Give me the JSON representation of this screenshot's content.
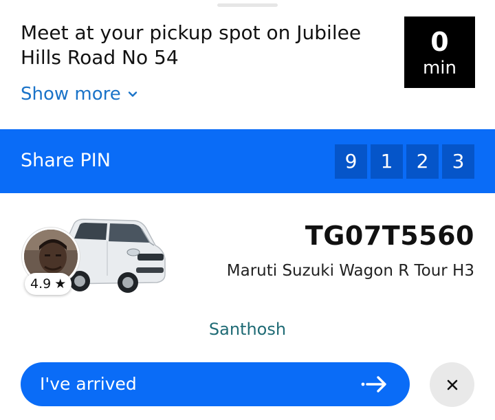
{
  "header": {
    "title": "Meet at your pickup spot on Jubilee Hills Road No 54",
    "show_more_label": "Show more",
    "eta": {
      "value": "0",
      "unit": "min"
    }
  },
  "pin": {
    "label": "Share PIN",
    "digits": [
      "9",
      "1",
      "2",
      "3"
    ]
  },
  "driver": {
    "rating": "4.9",
    "plate": "TG07T5560",
    "car_model": "Maruti Suzuki Wagon R Tour H3",
    "name": "Santhosh"
  },
  "actions": {
    "arrived_label": "I've arrived"
  },
  "colors": {
    "accent": "#0a6cf7",
    "pin_digit_bg": "#0555c9",
    "link": "#1a73c8",
    "driver_name": "#1f6b75"
  }
}
